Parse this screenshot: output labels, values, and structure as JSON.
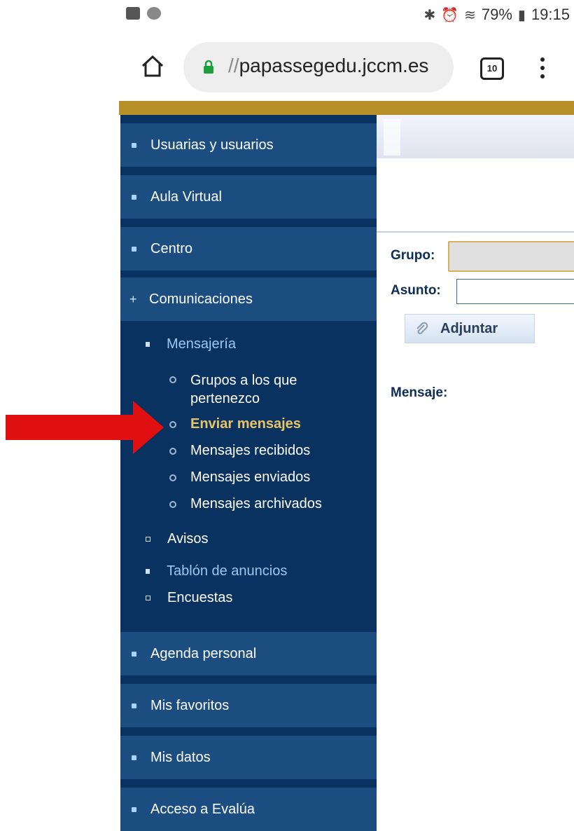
{
  "status_bar": {
    "battery_percent": "79%",
    "time": "19:15"
  },
  "browser": {
    "url_scheme": "//",
    "url_host": "papassegedu.jccm.es",
    "tab_count": "10"
  },
  "sidebar": {
    "sections_top": [
      {
        "label": "Usuarias y usuarios"
      },
      {
        "label": "Aula Virtual"
      },
      {
        "label": "Centro"
      },
      {
        "label": "Comunicaciones"
      }
    ],
    "comunicaciones": {
      "mensajeria_label": "Mensajería",
      "mensajeria_items": [
        {
          "label": "Grupos a los que pertenezco"
        },
        {
          "label": "Enviar mensajes"
        },
        {
          "label": "Mensajes recibidos"
        },
        {
          "label": "Mensajes enviados"
        },
        {
          "label": "Mensajes archivados"
        }
      ],
      "avisos_label": "Avisos",
      "tablon_label": "Tablón de anuncios",
      "encuestas_label": "Encuestas"
    },
    "sections_bottom": [
      {
        "label": "Agenda personal"
      },
      {
        "label": "Mis favoritos"
      },
      {
        "label": "Mis datos"
      },
      {
        "label": "Acceso a Evalúa"
      }
    ]
  },
  "form": {
    "grupo_label": "Grupo:",
    "asunto_label": "Asunto:",
    "adjuntar_label": "Adjuntar",
    "mensaje_label": "Mensaje:",
    "grupo_value": "",
    "asunto_value": ""
  },
  "colors": {
    "sidebar_bg": "#0a3260",
    "section_bg": "#1c4d80",
    "active_item": "#e8c368",
    "arrow": "#e01010"
  }
}
